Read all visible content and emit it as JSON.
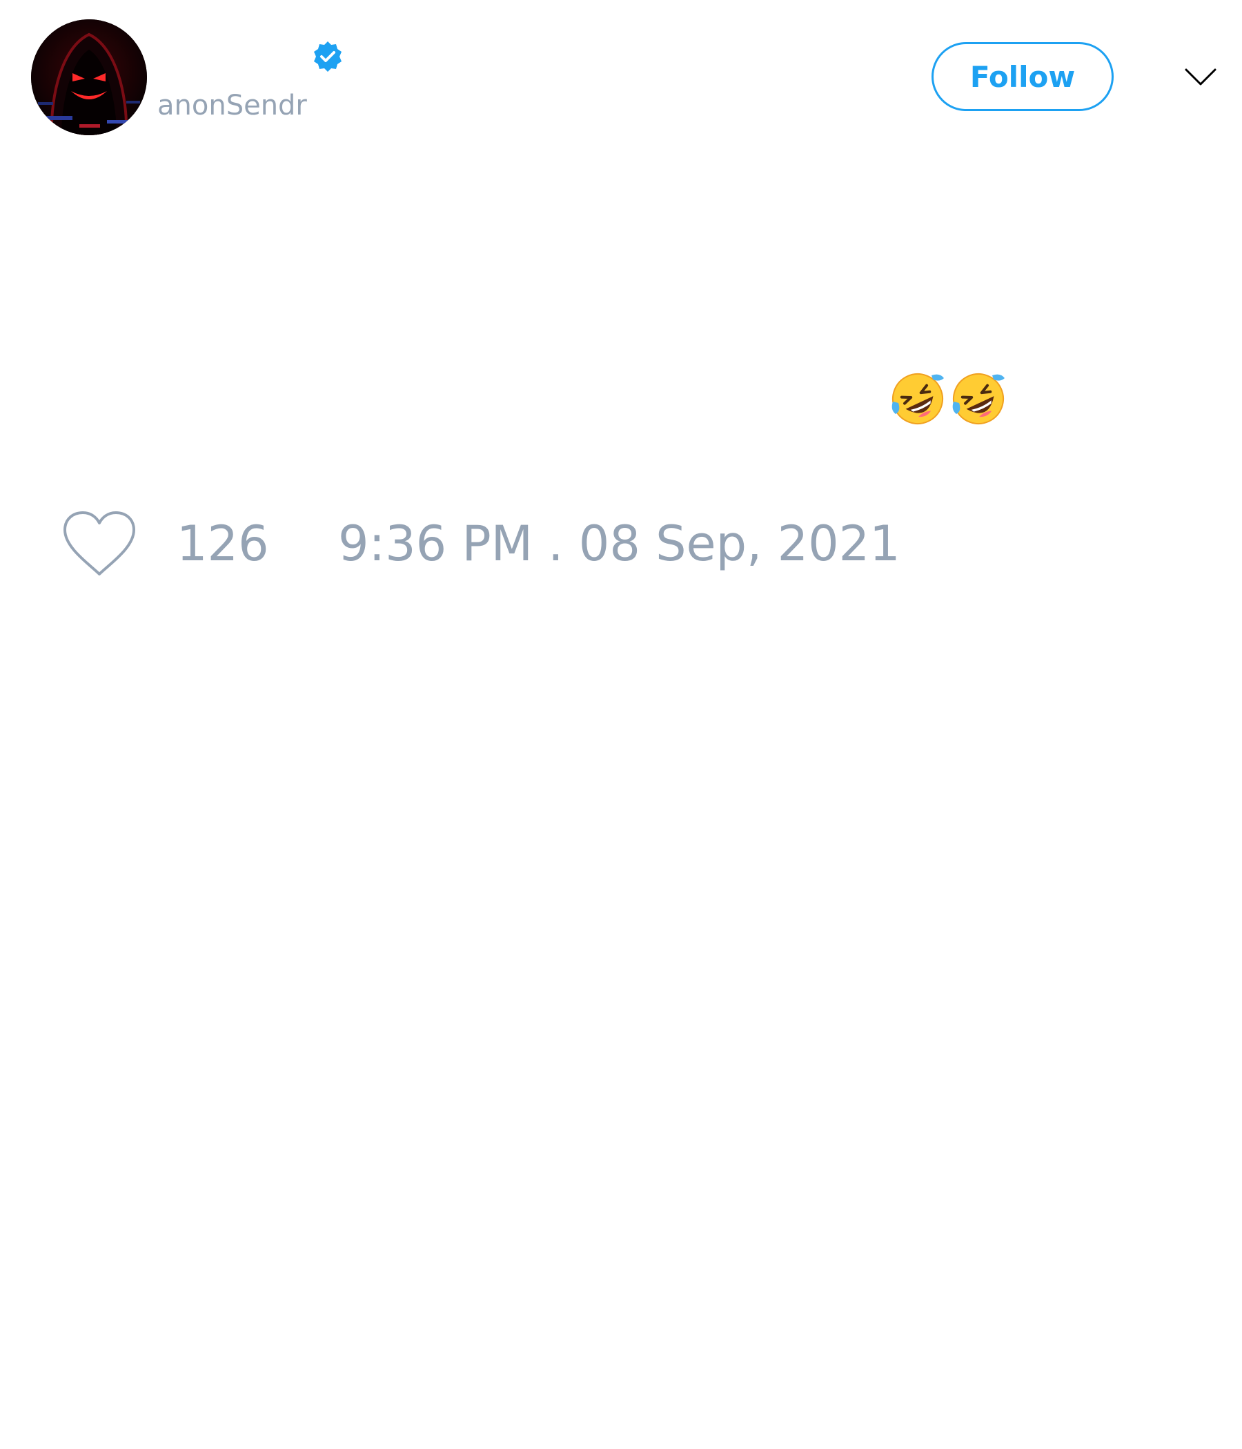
{
  "user": {
    "handle": "anonSendr",
    "avatar_icon": "hooded-figure-avatar",
    "verified_icon": "verified-badge-icon",
    "verified_color": "#1da1f2"
  },
  "header": {
    "follow_label": "Follow",
    "menu_icon": "chevron-down-icon"
  },
  "tweet": {
    "emojis": [
      "rolling-on-floor-laughing-emoji",
      "rolling-on-floor-laughing-emoji"
    ]
  },
  "footer": {
    "like_icon": "heart-icon",
    "like_count": "126",
    "timestamp": "9:36 PM . 08 Sep, 2021"
  },
  "colors": {
    "accent": "#1da1f2",
    "muted_text": "#95a3b4",
    "background": "#ffffff"
  }
}
